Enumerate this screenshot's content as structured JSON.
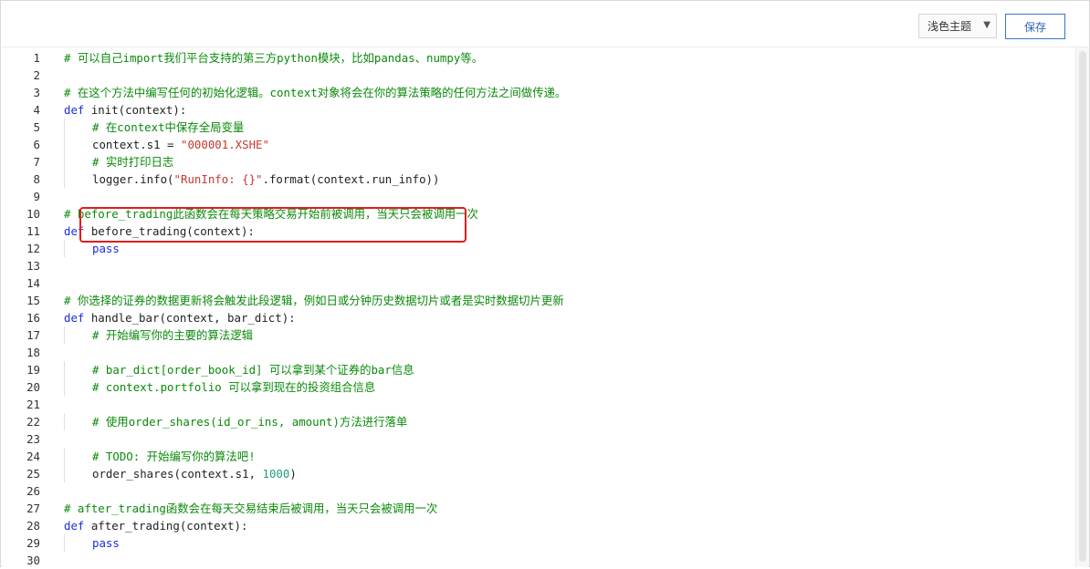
{
  "toolbar": {
    "theme_label": "浅色主题",
    "theme_caret": "▼",
    "save_label": "保存"
  },
  "editor": {
    "lines": [
      {
        "n": "1",
        "tokens": [
          {
            "c": "cm",
            "t": "# 可以自己import我们平台支持的第三方python模块，比如pandas、numpy等。"
          }
        ],
        "indent": 0
      },
      {
        "n": "2",
        "tokens": [],
        "indent": 0
      },
      {
        "n": "3",
        "tokens": [
          {
            "c": "cm",
            "t": "# 在这个方法中编写任何的初始化逻辑。context对象将会在你的算法策略的任何方法之间做传递。"
          }
        ],
        "indent": 0
      },
      {
        "n": "4",
        "tokens": [
          {
            "c": "kw",
            "t": "def "
          },
          {
            "c": "",
            "t": "init(context):"
          }
        ],
        "indent": 0
      },
      {
        "n": "5",
        "tokens": [
          {
            "c": "cm",
            "t": "# 在context中保存全局变量"
          }
        ],
        "indent": 1
      },
      {
        "n": "6",
        "tokens": [
          {
            "c": "",
            "t": "context.s1 = "
          },
          {
            "c": "st",
            "t": "\"000001.XSHE\""
          }
        ],
        "indent": 1
      },
      {
        "n": "7",
        "tokens": [
          {
            "c": "cm",
            "t": "# 实时打印日志"
          }
        ],
        "indent": 1
      },
      {
        "n": "8",
        "tokens": [
          {
            "c": "",
            "t": "logger.info("
          },
          {
            "c": "st",
            "t": "\"RunInfo: {}\""
          },
          {
            "c": "",
            "t": ".format(context.run_info))"
          }
        ],
        "indent": 1
      },
      {
        "n": "9",
        "tokens": [],
        "indent": 0
      },
      {
        "n": "10",
        "tokens": [
          {
            "c": "cm",
            "t": "# before_trading此函数会在每天策略交易开始前被调用，当天只会被调用一次"
          }
        ],
        "indent": 0
      },
      {
        "n": "11",
        "tokens": [
          {
            "c": "kw",
            "t": "def "
          },
          {
            "c": "",
            "t": "before_trading(context):"
          }
        ],
        "indent": 0
      },
      {
        "n": "12",
        "tokens": [
          {
            "c": "kw",
            "t": "pass"
          }
        ],
        "indent": 1
      },
      {
        "n": "13",
        "tokens": [],
        "indent": 0
      },
      {
        "n": "14",
        "tokens": [],
        "indent": 0
      },
      {
        "n": "15",
        "tokens": [
          {
            "c": "cm",
            "t": "# 你选择的证券的数据更新将会触发此段逻辑，例如日或分钟历史数据切片或者是实时数据切片更新"
          }
        ],
        "indent": 0
      },
      {
        "n": "16",
        "tokens": [
          {
            "c": "kw",
            "t": "def "
          },
          {
            "c": "",
            "t": "handle_bar(context, bar_dict):"
          }
        ],
        "indent": 0
      },
      {
        "n": "17",
        "tokens": [
          {
            "c": "cm",
            "t": "# 开始编写你的主要的算法逻辑"
          }
        ],
        "indent": 1
      },
      {
        "n": "18",
        "tokens": [],
        "indent": 0
      },
      {
        "n": "19",
        "tokens": [
          {
            "c": "cm",
            "t": "# bar_dict[order_book_id] 可以拿到某个证券的bar信息"
          }
        ],
        "indent": 1
      },
      {
        "n": "20",
        "tokens": [
          {
            "c": "cm",
            "t": "# context.portfolio 可以拿到现在的投资组合信息"
          }
        ],
        "indent": 1
      },
      {
        "n": "21",
        "tokens": [],
        "indent": 0
      },
      {
        "n": "22",
        "tokens": [
          {
            "c": "cm",
            "t": "# 使用order_shares(id_or_ins, amount)方法进行落单"
          }
        ],
        "indent": 1
      },
      {
        "n": "23",
        "tokens": [],
        "indent": 0
      },
      {
        "n": "24",
        "tokens": [
          {
            "c": "cm",
            "t": "# TODO: 开始编写你的算法吧!"
          }
        ],
        "indent": 1
      },
      {
        "n": "25",
        "tokens": [
          {
            "c": "",
            "t": "order_shares(context.s1, "
          },
          {
            "c": "nm",
            "t": "1000"
          },
          {
            "c": "",
            "t": ")"
          }
        ],
        "indent": 1
      },
      {
        "n": "26",
        "tokens": [],
        "indent": 0
      },
      {
        "n": "27",
        "tokens": [
          {
            "c": "cm",
            "t": "# after_trading函数会在每天交易结束后被调用，当天只会被调用一次"
          }
        ],
        "indent": 0
      },
      {
        "n": "28",
        "tokens": [
          {
            "c": "kw",
            "t": "def "
          },
          {
            "c": "",
            "t": "after_trading(context):"
          }
        ],
        "indent": 0
      },
      {
        "n": "29",
        "tokens": [
          {
            "c": "kw",
            "t": "pass"
          }
        ],
        "indent": 1
      },
      {
        "n": "30",
        "tokens": [],
        "indent": 0
      }
    ]
  },
  "annotation": {
    "color": "#e21d1d",
    "target_line": "8"
  }
}
